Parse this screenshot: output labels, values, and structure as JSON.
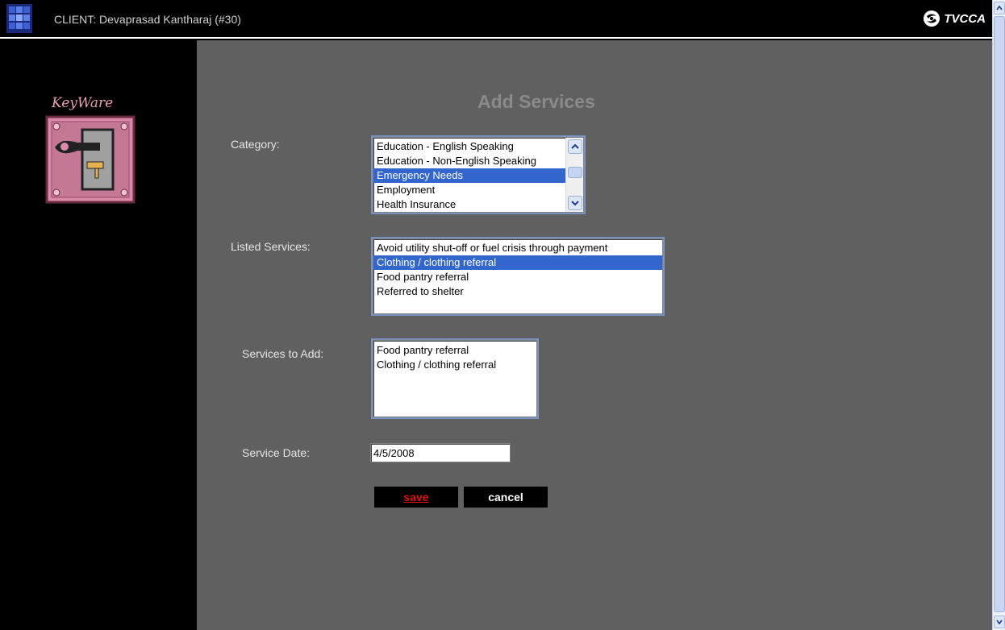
{
  "header": {
    "client_label": "CLIENT: Devaprasad Kantharaj (#30)",
    "brand": "TVCCA",
    "app_icon": "grid-app-icon",
    "brand_icon": "swirl-logo-icon"
  },
  "sidebar": {
    "brand_text": "KeyWare",
    "logo_icon": "key-lock-logo"
  },
  "main": {
    "title": "Add Services",
    "category_label": "Category:",
    "category_options": [
      "Education - English Speaking",
      "Education - Non-English Speaking",
      "Emergency Needs",
      "Employment",
      "Health Insurance"
    ],
    "category_selected": "Emergency Needs",
    "listed_label": "Listed Services:",
    "listed_options": [
      "Avoid utility shut-off or fuel crisis through payment",
      "Clothing / clothing referral",
      "Food pantry referral",
      "Referred to shelter"
    ],
    "listed_selected": "Clothing / clothing referral",
    "toadd_label": "Services to Add:",
    "toadd_options": [
      "Food pantry referral",
      "Clothing / clothing referral"
    ],
    "date_label": "Service Date:",
    "date_value": "4/5/2008",
    "save_label": "save",
    "cancel_label": "cancel"
  },
  "colors": {
    "main_bg": "#606060",
    "selection": "#3366cc",
    "save_text": "#e01010"
  }
}
